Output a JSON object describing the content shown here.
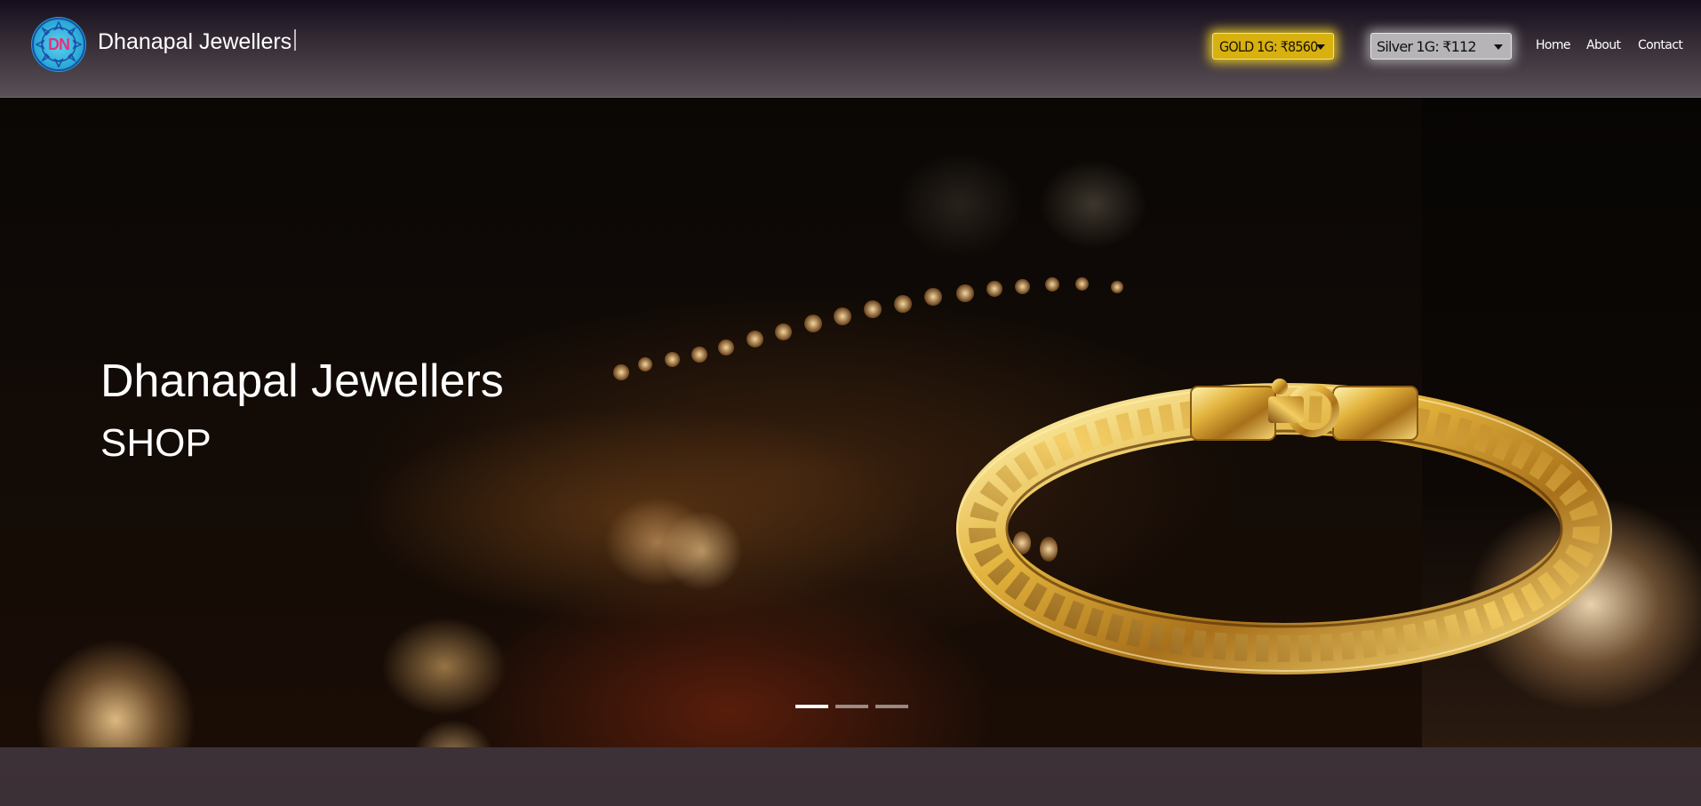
{
  "brand": {
    "logo_text": "DN",
    "name": "Dhanapal Jewellers"
  },
  "rates": {
    "gold_label": "GOLD 1G: ₹8560",
    "silver_label": "Silver 1G: ₹112"
  },
  "nav": {
    "items": [
      {
        "label": "Home"
      },
      {
        "label": "About"
      },
      {
        "label": "Contact"
      }
    ]
  },
  "hero": {
    "title": "Dhanapal Jewellers",
    "subtitle": "SHOP",
    "slide_count": 3,
    "active_slide": 1
  },
  "colors": {
    "gold_accent": "#d8b10f",
    "silver_accent": "#b6b4b6",
    "logo_ring": "#2aa9d6",
    "logo_text": "#e0347a"
  },
  "icons": [
    "logo-emblem-icon",
    "chevron-down-icon"
  ]
}
